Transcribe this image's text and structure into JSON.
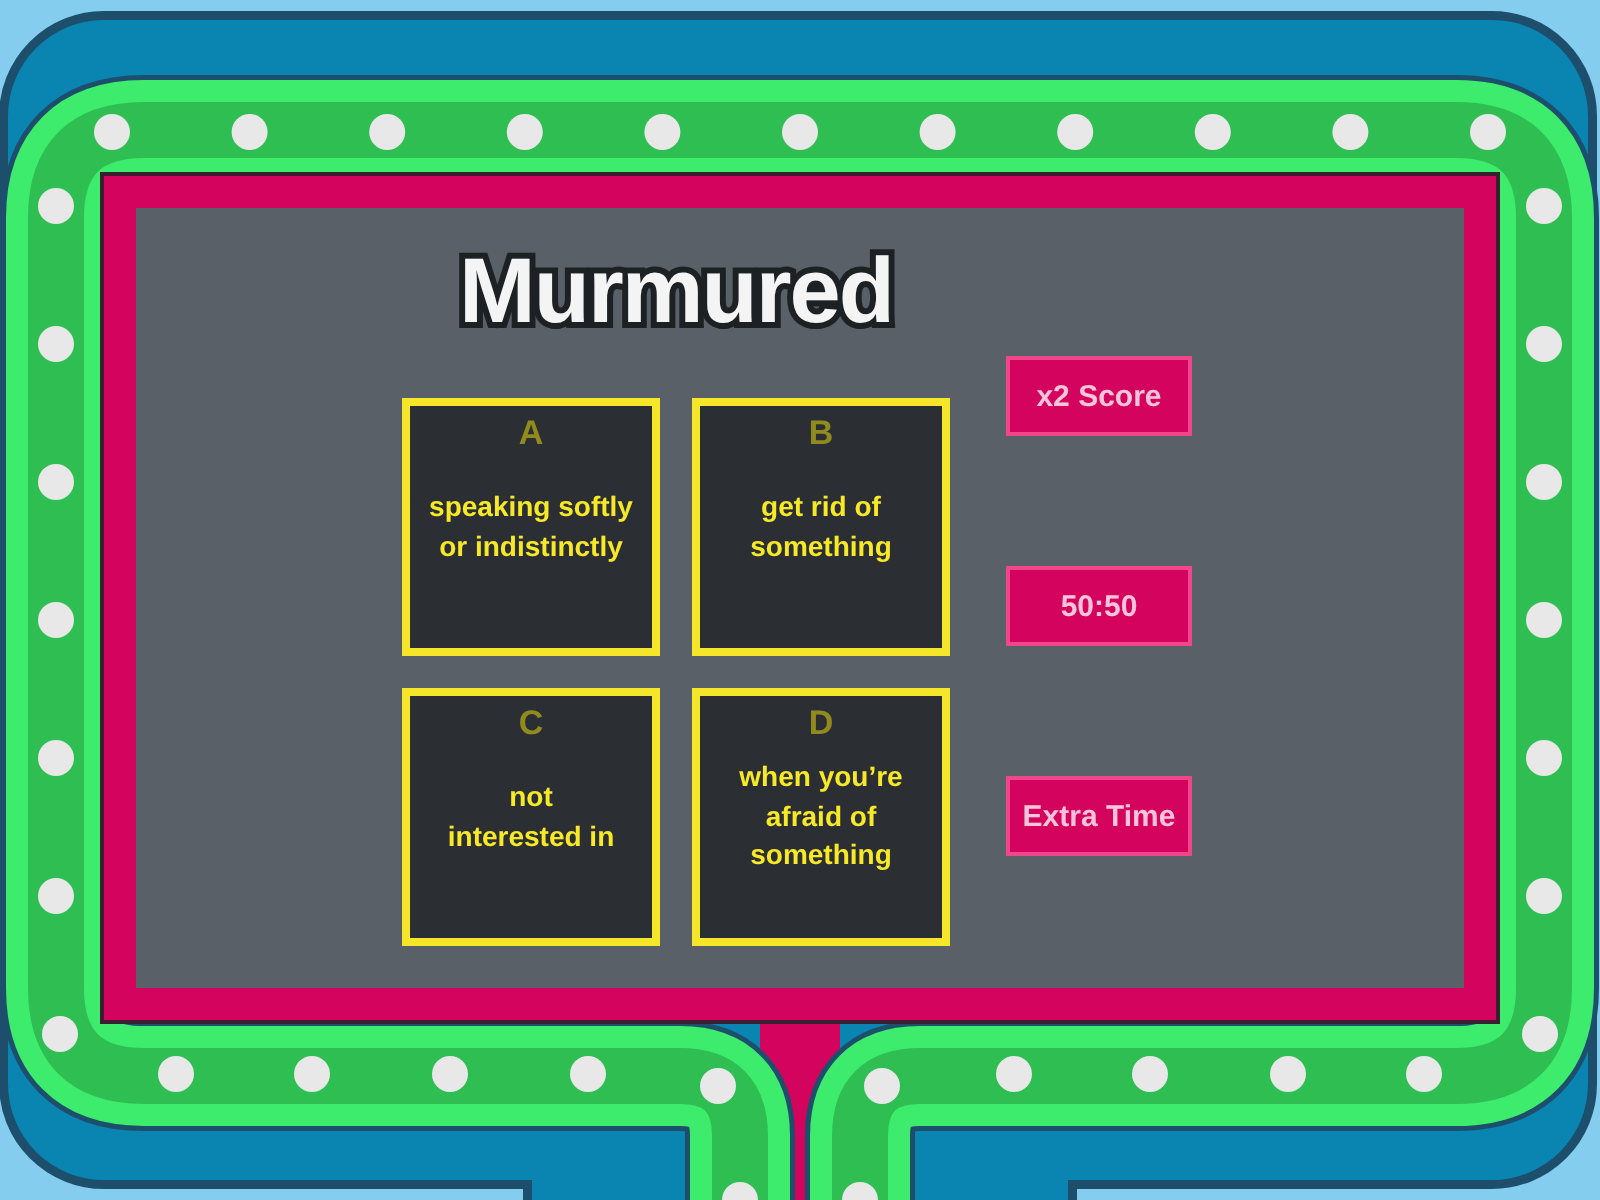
{
  "title": "Murmured",
  "answers": [
    {
      "letter": "A",
      "text": "speaking softly\nor indistinctly"
    },
    {
      "letter": "B",
      "text": "get rid of\nsomething"
    },
    {
      "letter": "C",
      "text": "not\ninterested in"
    },
    {
      "letter": "D",
      "text": "when you’re\nafraid of\nsomething"
    }
  ],
  "power_ups": [
    {
      "label": "x2 Score"
    },
    {
      "label": "50:50"
    },
    {
      "label": "Extra Time"
    }
  ]
}
